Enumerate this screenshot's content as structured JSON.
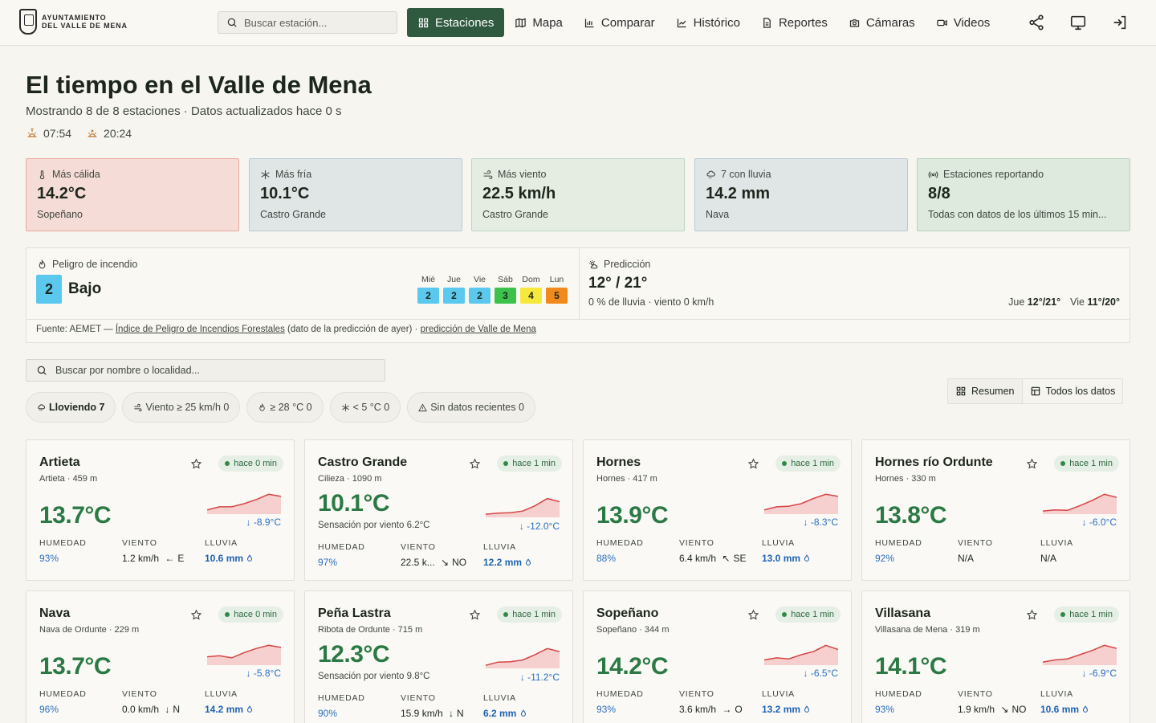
{
  "logo": {
    "line1": "AYUNTAMIENTO",
    "line2": "DEL VALLE DE MENA"
  },
  "topbar": {
    "search_placeholder": "Buscar estación...",
    "nav": [
      "Estaciones",
      "Mapa",
      "Comparar",
      "Histórico",
      "Reportes",
      "Cámaras",
      "Videos"
    ],
    "active_nav": "Estaciones"
  },
  "header": {
    "title": "El tiempo en el Valle de Mena",
    "subtitle": "Mostrando 8 de 8 estaciones · Datos actualizados hace 0 s",
    "sunrise": "07:54",
    "sunset": "20:24"
  },
  "summary": [
    {
      "label": "Más cálida",
      "value": "14.2°C",
      "sub": "Sopeñano",
      "bg": "#f5dcd6",
      "border": "#e8a99e",
      "icon": "thermometer-icon"
    },
    {
      "label": "Más fría",
      "value": "10.1°C",
      "sub": "Castro Grande",
      "bg": "#e0e6e6",
      "border": "#b9cad4",
      "icon": "snowflake-icon"
    },
    {
      "label": "Más viento",
      "value": "22.5 km/h",
      "sub": "Castro Grande",
      "bg": "#e5ede3",
      "border": "#bcd7c4",
      "icon": "wind-icon"
    },
    {
      "label": "7 con lluvia",
      "value": "14.2 mm",
      "sub": "Nava",
      "bg": "#e0e6e6",
      "border": "#b9cad4",
      "icon": "rain-cloud-icon"
    },
    {
      "label": "Estaciones reportando",
      "value": "8/8",
      "sub": "Todas con datos de los últimos 15 min...",
      "bg": "#dfeadf",
      "border": "#b8d1bc",
      "icon": "signal-icon"
    }
  ],
  "fire": {
    "label": "Peligro de incendio",
    "level_num": "2",
    "level_text": "Bajo",
    "days": [
      {
        "day": "Mié",
        "level": "2",
        "color": "#5bc8ee"
      },
      {
        "day": "Jue",
        "level": "2",
        "color": "#5bc8ee"
      },
      {
        "day": "Vie",
        "level": "2",
        "color": "#5bc8ee"
      },
      {
        "day": "Sáb",
        "level": "3",
        "color": "#3cc24b"
      },
      {
        "day": "Dom",
        "level": "4",
        "color": "#f7e93b"
      },
      {
        "day": "Lun",
        "level": "5",
        "color": "#f08a1c"
      }
    ]
  },
  "prediction": {
    "label": "Predicción",
    "value": "12° / 21°",
    "sub": "0 % de lluvia · viento 0 km/h",
    "days": [
      {
        "day": "Jue",
        "range": "12°/21°"
      },
      {
        "day": "Vie",
        "range": "11°/20°"
      }
    ]
  },
  "source": {
    "prefix": "Fuente: AEMET — ",
    "link1": "Índice de Peligro de Incendios Forestales",
    "middle": " (dato de la predicción de ayer) · ",
    "link2": "predicción de Valle de Mena"
  },
  "filters": {
    "search_placeholder": "Buscar por nombre o localidad...",
    "chips": [
      "Lloviendo 7",
      "Viento ≥ 25 km/h 0",
      "≥ 28 °C 0",
      "< 5 °C 0",
      "Sin datos recientes 0"
    ],
    "view_summary": "Resumen",
    "view_all": "Todos los datos"
  },
  "stat_labels": {
    "humidity": "HUMEDAD",
    "wind": "VIENTO",
    "rain": "LLUVIA"
  },
  "stations": [
    {
      "name": "Artieta",
      "loc": "Artieta · 459 m",
      "ago": "hace 0 min",
      "temp": "13.7°C",
      "feel": "",
      "delta": "↓ -8.9°C",
      "humidity": "93%",
      "wind": "1.2 km/h",
      "wind_dir": "E",
      "rain": "10.6 mm",
      "trend": [
        0.2,
        0.35,
        0.35,
        0.5,
        0.7,
        0.95,
        0.85
      ]
    },
    {
      "name": "Castro Grande",
      "loc": "Cilieza · 1090 m",
      "ago": "hace 1 min",
      "temp": "10.1°C",
      "feel": "Sensación por viento 6.2°C",
      "delta": "↓ -12.0°C",
      "humidity": "97%",
      "wind": "22.5 k...",
      "wind_dir": "NO",
      "rain": "12.2 mm",
      "trend": [
        0.15,
        0.2,
        0.22,
        0.3,
        0.55,
        0.9,
        0.75
      ]
    },
    {
      "name": "Hornes",
      "loc": "Hornes · 417 m",
      "ago": "hace 1 min",
      "temp": "13.9°C",
      "feel": "",
      "delta": "↓ -8.3°C",
      "humidity": "88%",
      "wind": "6.4 km/h",
      "wind_dir": "SE",
      "rain": "13.0 mm",
      "trend": [
        0.2,
        0.35,
        0.38,
        0.5,
        0.75,
        0.95,
        0.85
      ]
    },
    {
      "name": "Hornes río Ordunte",
      "loc": "Hornes · 330 m",
      "ago": "hace 1 min",
      "temp": "13.8°C",
      "feel": "",
      "delta": "↓ -6.0°C",
      "humidity": "92%",
      "wind": "N/A",
      "wind_dir": "",
      "rain": "N/A",
      "trend": [
        0.15,
        0.2,
        0.18,
        0.4,
        0.65,
        0.95,
        0.8
      ]
    },
    {
      "name": "Nava",
      "loc": "Nava de Ordunte · 229 m",
      "ago": "hace 0 min",
      "temp": "13.7°C",
      "feel": "",
      "delta": "↓ -5.8°C",
      "humidity": "96%",
      "wind": "0.0 km/h",
      "wind_dir": "N",
      "rain": "14.2 mm",
      "trend": [
        0.4,
        0.45,
        0.35,
        0.6,
        0.8,
        0.95,
        0.85
      ]
    },
    {
      "name": "Peña Lastra",
      "loc": "Ribota de Ordunte · 715 m",
      "ago": "hace 1 min",
      "temp": "12.3°C",
      "feel": "Sensación por viento 9.8°C",
      "delta": "↓ -11.2°C",
      "humidity": "90%",
      "wind": "15.9 km/h",
      "wind_dir": "N",
      "rain": "6.2 mm",
      "trend": [
        0.15,
        0.3,
        0.32,
        0.4,
        0.65,
        0.95,
        0.8
      ]
    },
    {
      "name": "Sopeñano",
      "loc": "Sopeñano · 344 m",
      "ago": "hace 1 min",
      "temp": "14.2°C",
      "feel": "",
      "delta": "↓ -6.5°C",
      "humidity": "93%",
      "wind": "3.6 km/h",
      "wind_dir": "O",
      "rain": "13.2 mm",
      "trend": [
        0.25,
        0.35,
        0.3,
        0.5,
        0.65,
        0.95,
        0.75
      ]
    },
    {
      "name": "Villasana",
      "loc": "Villasana de Mena · 319 m",
      "ago": "hace 1 min",
      "temp": "14.1°C",
      "feel": "",
      "delta": "↓ -6.9°C",
      "humidity": "93%",
      "wind": "1.9 km/h",
      "wind_dir": "NO",
      "rain": "10.6 mm",
      "trend": [
        0.15,
        0.25,
        0.3,
        0.5,
        0.7,
        0.95,
        0.8
      ]
    }
  ]
}
